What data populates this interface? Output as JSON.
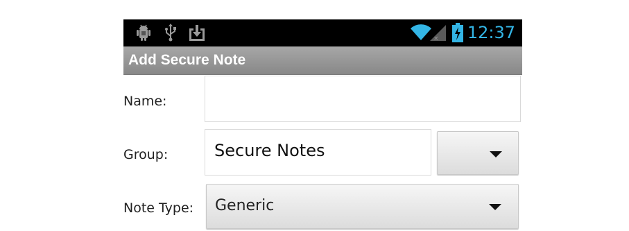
{
  "status_bar": {
    "time": "12:37",
    "left_icons": [
      "android-debug-icon",
      "usb-icon",
      "download-icon"
    ],
    "right_icons": [
      "wifi-icon",
      "signal-icon",
      "battery-charging-icon"
    ],
    "accent_color": "#33b5e5"
  },
  "action_bar": {
    "title": "Add Secure Note"
  },
  "form": {
    "name": {
      "label": "Name:",
      "value": ""
    },
    "group": {
      "label": "Group:",
      "value": "Secure Notes"
    },
    "note_type": {
      "label": "Note Type:",
      "value": "Generic"
    }
  }
}
